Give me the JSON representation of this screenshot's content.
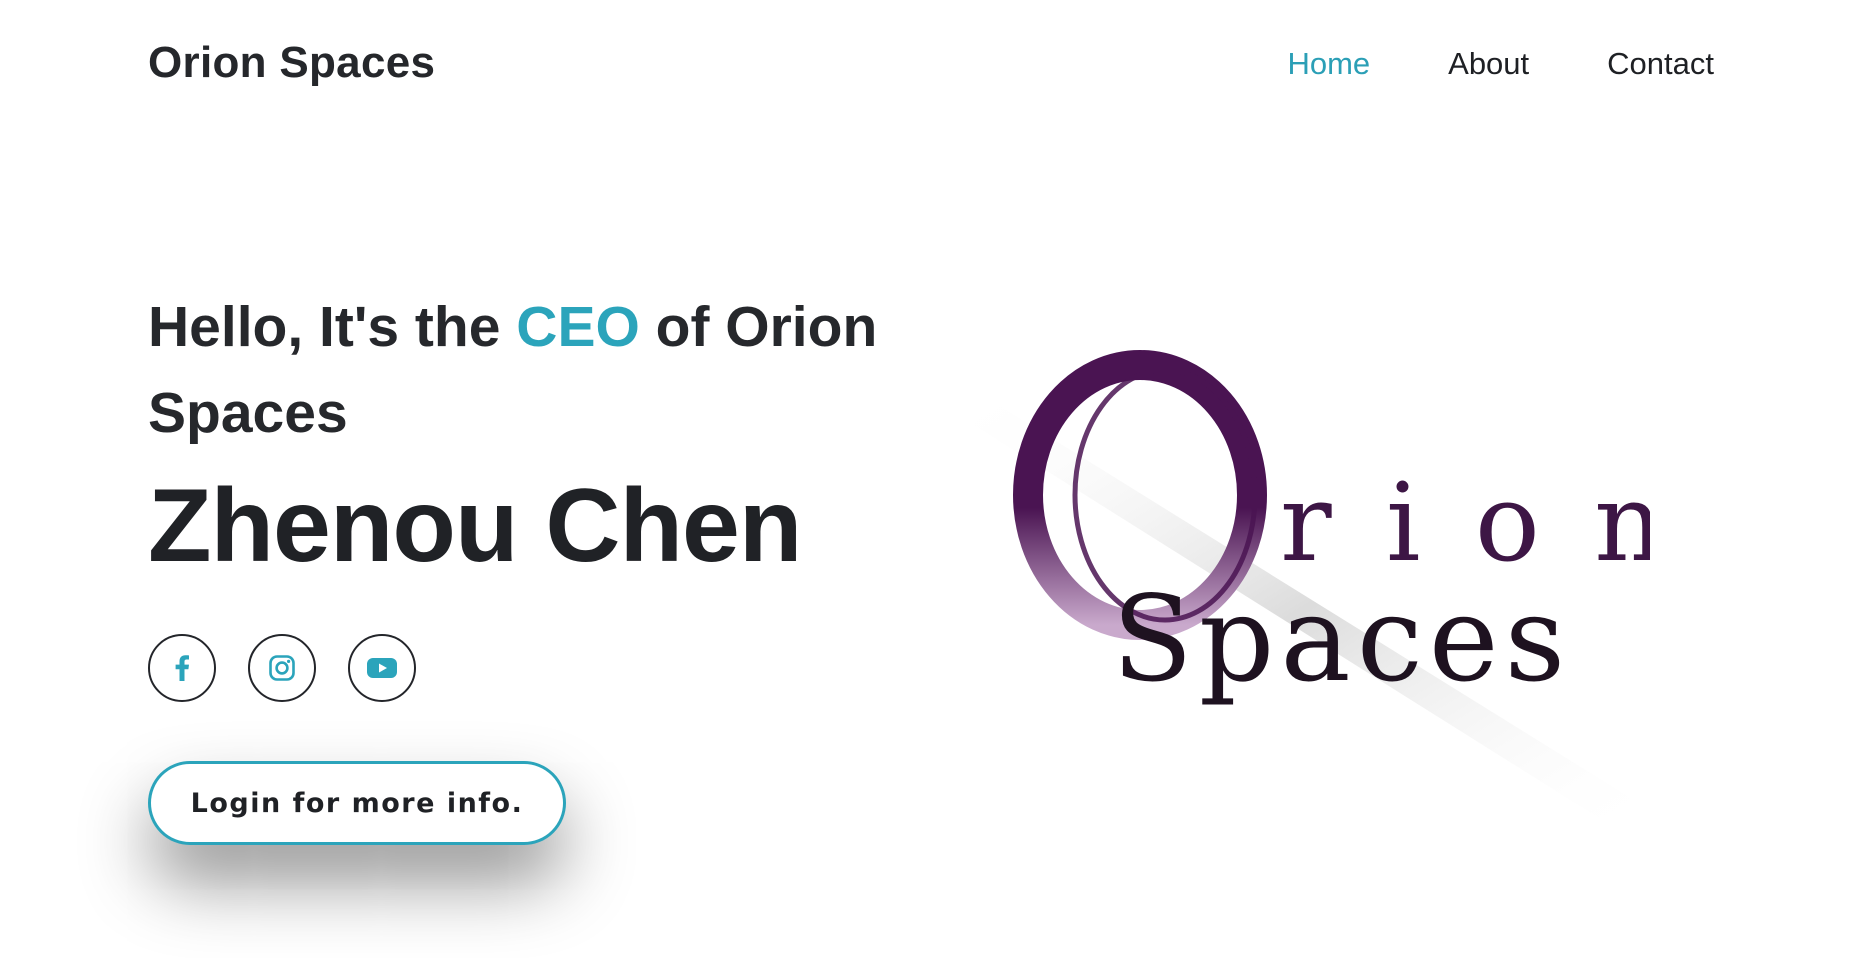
{
  "header": {
    "brand": "Orion Spaces",
    "nav": [
      {
        "label": "Home",
        "active": true
      },
      {
        "label": "About",
        "active": false
      },
      {
        "label": "Contact",
        "active": false
      }
    ]
  },
  "hero": {
    "headline_prefix": "Hello, It's the ",
    "headline_accent": "CEO",
    "headline_suffix": " of Orion Spaces",
    "name": "Zhenou Chen",
    "social_icons": [
      "facebook-icon",
      "instagram-icon",
      "youtube-icon"
    ],
    "cta_label": "Login for more info."
  },
  "logo": {
    "big_letter": "O",
    "line1_rest": "r i o n",
    "line2": "Spaces"
  },
  "colors": {
    "accent": "#2ba4bb",
    "text": "#222428",
    "logo_purple": "#4a1452"
  }
}
